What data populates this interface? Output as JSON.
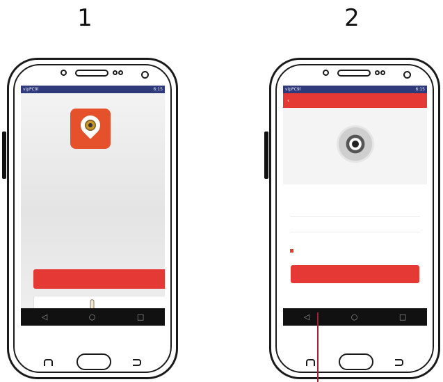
{
  "steps": [
    {
      "number": "1",
      "status_left": "vipPC9l",
      "status_right": "6:15",
      "primary_button": "",
      "nav_icons": [
        "◁",
        "○",
        "□"
      ]
    },
    {
      "number": "2",
      "status_left": "vipPC9l",
      "status_right": "6:15",
      "title": "",
      "back_icon": "‹",
      "fields": [
        {
          "label": "",
          "value": ""
        },
        {
          "label": "",
          "value": ""
        }
      ],
      "remember_label": "",
      "forgot_label": "",
      "primary_button": "",
      "hint_left": "",
      "hint_right": "",
      "nav_icons": [
        "◁",
        "○",
        "□"
      ]
    }
  ],
  "colors": {
    "accent": "#e53935",
    "status_bar": "#2f3a7a",
    "nav_bar": "#111111",
    "pointer_line": "#a3213c"
  }
}
